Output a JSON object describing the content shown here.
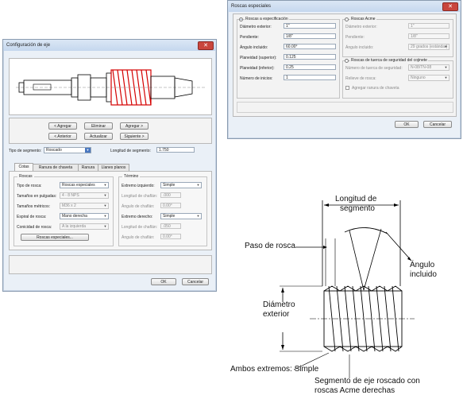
{
  "axis_dialog": {
    "title": "Configuración de eje",
    "buttons": {
      "add_before": "< Agregar",
      "delete": "Eliminar",
      "add_after": "Agregar >",
      "previous": "< Anterior",
      "update": "Actualizar",
      "next": "Siguiente >",
      "ok": "OK",
      "cancel": "Cancelar"
    },
    "segment_type_label": "Tipo de segmento:",
    "segment_type_value": "Roscado",
    "segment_length_label": "Longitud de segmento:",
    "segment_length_value": "1.750",
    "tabs": [
      "Cotas",
      "Ranura de chaveta",
      "Ranura",
      "Llanes planos"
    ],
    "threads_group": {
      "title": "Roscas",
      "thread_type_label": "Tipo de rosca:",
      "thread_type_value": "Roscas especiales",
      "inch_sizes_label": "Tamaños en pulgadas:",
      "inch_sizes_value": "4 - 8 NPS",
      "metric_sizes_label": "Tamaños métricos:",
      "metric_sizes_value": "M36 x 2",
      "thread_spiral_label": "Espiral de rosca:",
      "thread_spiral_value": "Mano derecha",
      "thread_taper_label": "Conicidad de rosca:",
      "thread_taper_value": "A la izquierda",
      "special_button": "Roscas especiales..."
    },
    "ends_group": {
      "title": "Término",
      "left_end_label": "Extremo izquierdo:",
      "left_end_value": "Simple",
      "chamfer_len_label": "Longitud de chaflán:",
      "chamfer_len_value": ".000",
      "chamfer_ang_label": "Ángulo de chaflán:",
      "chamfer_ang_value": "0.00°",
      "right_end_label": "Extremo derecho:",
      "right_end_value": "Simple",
      "chamfer_len2_label": "Longitud de chaflán:",
      "chamfer_len2_value": ".050",
      "chamfer_ang2_label": "Ángulo de chaflán:",
      "chamfer_ang2_value": "0.00°"
    }
  },
  "thread_dialog": {
    "title": "Roscas especiales",
    "spec_radio": "Roscas a especificación",
    "acme_radio": "Roscas Acme",
    "safety_radio": "Roscas de tuerca de seguridad del cojinete",
    "fields": [
      {
        "label": "Diámetro exterior:",
        "value": "1\""
      },
      {
        "label": "Pendiente:",
        "value": "1/8\""
      },
      {
        "label": "Ángulo incluido:",
        "value": "60.00°"
      },
      {
        "label": "Planeidad (superior):",
        "value": "0.125"
      },
      {
        "label": "Planeidad (inferior):",
        "value": "0.25"
      },
      {
        "label": "Número de inicios:",
        "value": "1"
      }
    ],
    "acme_fields": [
      {
        "label": "Diámetro exterior:",
        "value": "1\""
      },
      {
        "label": "Pendiente:",
        "value": "1/8\""
      },
      {
        "label": "Ángulo incluido:",
        "value": "29 grados (estándar)"
      }
    ],
    "safety_fields": [
      {
        "label": "Número de tuerca de seguridad:",
        "value": "N-08/TN-08"
      },
      {
        "label": "Relieve de rosca:",
        "value": "Ninguno"
      }
    ],
    "keyway_check": "Agregar ranura de chaveta",
    "ok": "OK",
    "cancel": "Cancelar"
  },
  "diagram": {
    "length_label_1": "Longitud de",
    "length_label_2": "segmento",
    "pitch_label": "Paso de rosca",
    "angle_label_1": "Ángulo",
    "angle_label_2": "incluido",
    "diameter_label_1": "Diámetro",
    "diameter_label_2": "exterior",
    "ends_label": "Ambos extremos: Simple",
    "caption_1": "Segmento de eje roscado con",
    "caption_2": "roscas Acme derechas"
  }
}
